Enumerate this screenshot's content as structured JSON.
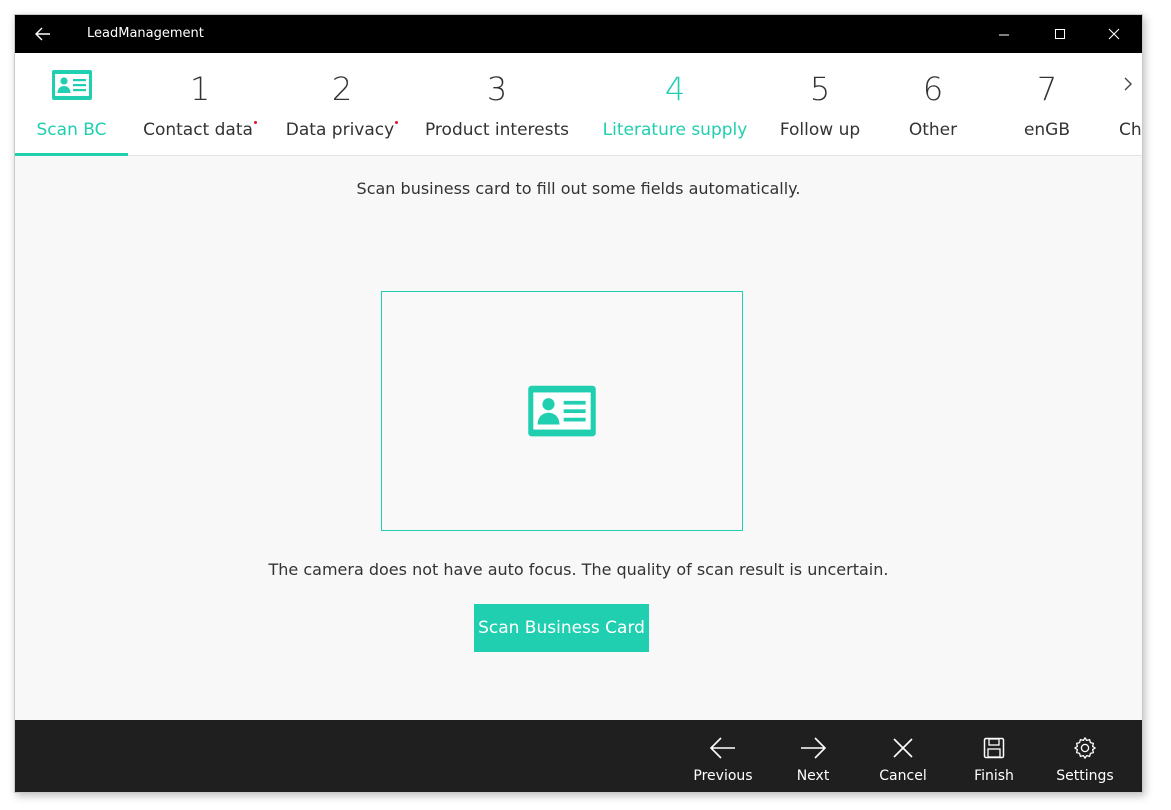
{
  "window": {
    "title": "LeadManagement"
  },
  "colors": {
    "accent": "#1fcfb0",
    "required_dot": "#e81123",
    "titlebar": "#000000",
    "bottombar": "#1f1f1f"
  },
  "tabs": [
    {
      "num": "",
      "label": "Scan BC",
      "icon": "business-card-icon",
      "required": false
    },
    {
      "num": "1",
      "label": "Contact data",
      "required": true
    },
    {
      "num": "2",
      "label": "Data privacy",
      "required": true
    },
    {
      "num": "3",
      "label": "Product interests",
      "required": false
    },
    {
      "num": "4",
      "label": "Literature supply",
      "required": false
    },
    {
      "num": "5",
      "label": "Follow up",
      "required": false
    },
    {
      "num": "6",
      "label": "Other",
      "required": false
    },
    {
      "num": "7",
      "label": "enGB",
      "required": false
    },
    {
      "num": "",
      "label": "Ch",
      "required": false
    }
  ],
  "main": {
    "hint": "Scan business card to fill out some fields automatically.",
    "warning": "The camera does not have auto focus. The quality of scan result is uncertain.",
    "scan_button": "Scan Business Card"
  },
  "bottombar": {
    "previous": "Previous",
    "next": "Next",
    "cancel": "Cancel",
    "finish": "Finish",
    "settings": "Settings"
  }
}
